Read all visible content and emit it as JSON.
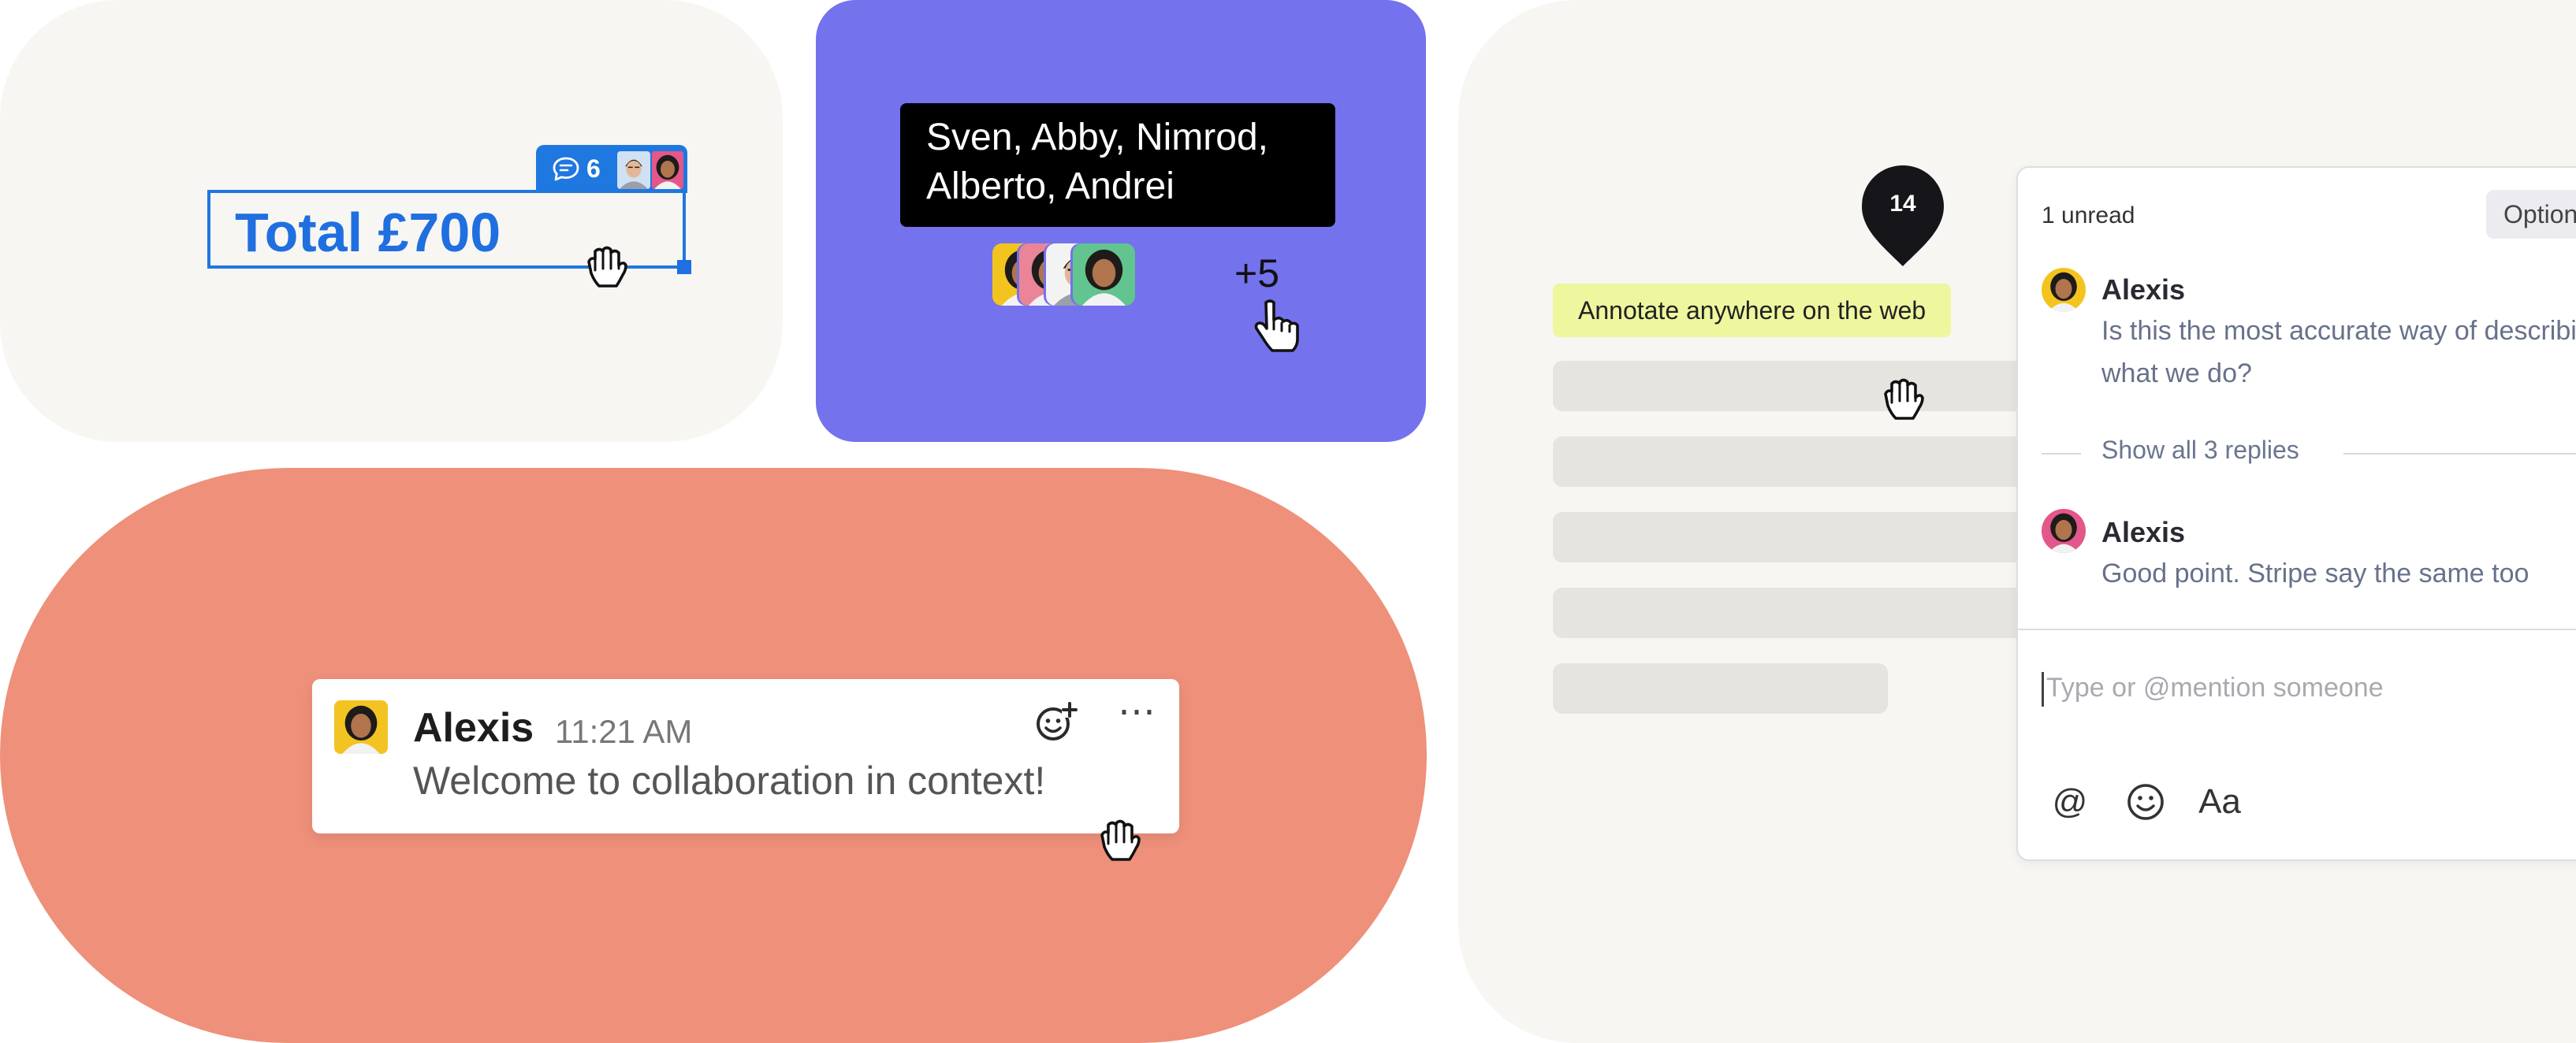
{
  "spreadsheet_card": {
    "cell_value": "Total £700",
    "comment_count": "6"
  },
  "presence_card": {
    "tooltip_line1": "Sven, Abby, Nimrod,",
    "tooltip_line2": "Alberto, Andrei",
    "more_count": "+5",
    "avatar_colors": [
      "#f4c41e",
      "#e98596",
      "#f3f3f3",
      "#62c48e"
    ]
  },
  "message_card": {
    "author": "Alexis",
    "time": "11:21 AM",
    "text": "Welcome to collaboration in context!",
    "more_label": "⋯"
  },
  "annotate_card": {
    "pin_number": "14",
    "label": "Annotate anywhere on the web",
    "thread": {
      "unread_label": "1 unread",
      "options_label": "Options",
      "comments": [
        {
          "author": "Alexis",
          "line1": "Is this the most accurate way of describing",
          "line2": "what we do?"
        },
        {
          "author": "Alexis",
          "line1": "Good point. Stripe say the same too"
        }
      ],
      "show_replies_label": "Show all 3 replies",
      "input_placeholder": "Type or @mention someone",
      "tools": {
        "mention": "@",
        "format": "Aa"
      }
    }
  },
  "colors": {
    "accent_blue": "#1f6fe0",
    "presence_purple": "#7472ec",
    "message_coral": "#ee907a",
    "card_cream": "#f7f6f2",
    "annotate_yellow": "#eef79e"
  }
}
